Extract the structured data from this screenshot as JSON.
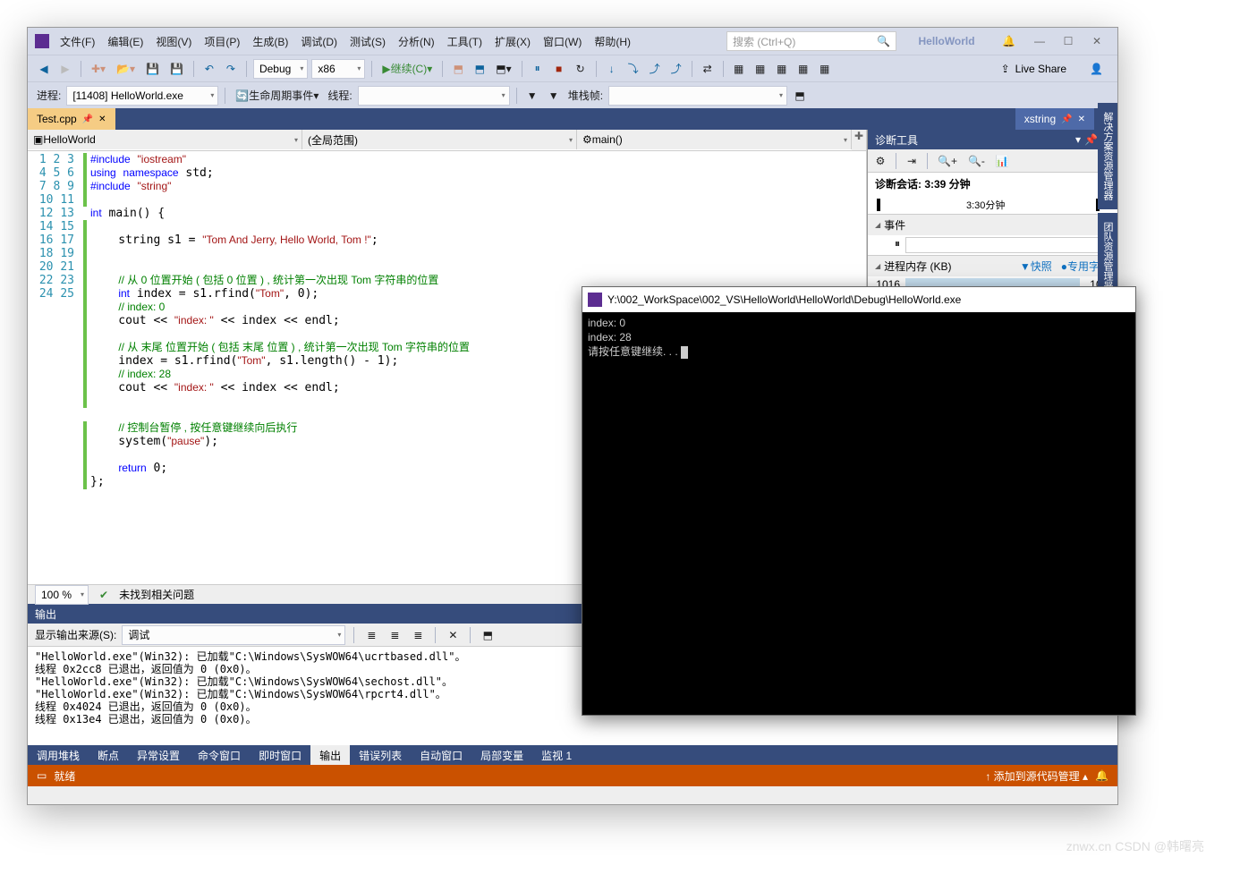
{
  "window_title": "HelloWorld",
  "menu": [
    "文件(F)",
    "编辑(E)",
    "视图(V)",
    "项目(P)",
    "生成(B)",
    "调试(D)",
    "测试(S)",
    "分析(N)",
    "工具(T)",
    "扩展(X)",
    "窗口(W)",
    "帮助(H)"
  ],
  "search_placeholder": "搜索 (Ctrl+Q)",
  "toolbar1": {
    "config": "Debug",
    "platform": "x86",
    "continue": "继续(C)",
    "liveshare": "Live Share"
  },
  "toolbar2": {
    "process_label": "进程:",
    "process_value": "[11408] HelloWorld.exe",
    "lifecycle": "生命周期事件",
    "thread_label": "线程:",
    "stackframe_label": "堆栈帧:"
  },
  "tabs": {
    "active": "Test.cpp",
    "right": "xstring"
  },
  "nav": {
    "project": "HelloWorld",
    "scope": "(全局范围)",
    "func": "main()"
  },
  "code_lines": [
    {
      "n": 1,
      "h": "<span class='kw'>#include</span> <span class='str'>\"iostream\"</span>"
    },
    {
      "n": 2,
      "h": "<span class='kw'>using</span> <span class='kw'>namespace</span> std;"
    },
    {
      "n": 3,
      "h": "<span class='kw'>#include</span> <span class='str'>\"string\"</span>"
    },
    {
      "n": 4,
      "h": ""
    },
    {
      "n": 5,
      "h": "<span class='kw'>int</span> main() {"
    },
    {
      "n": 6,
      "h": ""
    },
    {
      "n": 7,
      "h": "    string s1 = <span class='str'>\"Tom And Jerry, Hello World, Tom !\"</span>;"
    },
    {
      "n": 8,
      "h": ""
    },
    {
      "n": 9,
      "h": ""
    },
    {
      "n": 10,
      "h": "    <span class='cmt'>// 从 0 位置开始 ( 包括 0 位置 ) , 统计第一次出现 Tom 字符串的位置</span>"
    },
    {
      "n": 11,
      "h": "    <span class='kw'>int</span> index = s1.rfind(<span class='str'>\"Tom\"</span>, 0);"
    },
    {
      "n": 12,
      "h": "    <span class='cmt'>// index: 0</span>"
    },
    {
      "n": 13,
      "h": "    cout &lt;&lt; <span class='str'>\"index: \"</span> &lt;&lt; index &lt;&lt; endl;"
    },
    {
      "n": 14,
      "h": ""
    },
    {
      "n": 15,
      "h": "    <span class='cmt'>// 从 末尾 位置开始 ( 包括 末尾 位置 ) , 统计第一次出现 Tom 字符串的位置</span>"
    },
    {
      "n": 16,
      "h": "    index = s1.rfind(<span class='str'>\"Tom\"</span>, s1.length() - 1);"
    },
    {
      "n": 17,
      "h": "    <span class='cmt'>// index: 28</span>"
    },
    {
      "n": 18,
      "h": "    cout &lt;&lt; <span class='str'>\"index: \"</span> &lt;&lt; index &lt;&lt; endl;"
    },
    {
      "n": 19,
      "h": ""
    },
    {
      "n": 20,
      "h": ""
    },
    {
      "n": 21,
      "h": "    <span class='cmt'>// 控制台暂停 , 按任意键继续向后执行</span>"
    },
    {
      "n": 22,
      "h": "    system(<span class='str'>\"pause\"</span>);"
    },
    {
      "n": 23,
      "h": ""
    },
    {
      "n": 24,
      "h": "    <span class='kw'>return</span> 0;"
    },
    {
      "n": 25,
      "h": "};"
    }
  ],
  "zoom": "100 %",
  "issues": "未找到相关问题",
  "diag": {
    "title": "诊断工具",
    "session": "诊断会话: 3:39 分钟",
    "tick": "3:30分钟",
    "events": "事件",
    "memory": "进程内存 (KB)",
    "snapshot": "快照",
    "private": "专用字节",
    "val": "1016"
  },
  "side_tabs": [
    "解决方案资源管理器",
    "团队资源管理器"
  ],
  "output": {
    "title": "输出",
    "source_label": "显示输出来源(S):",
    "source_value": "调试",
    "text": "\"HelloWorld.exe\"(Win32): 已加载\"C:\\Windows\\SysWOW64\\ucrtbased.dll\"。\n线程 0x2cc8 已退出，返回值为 0 (0x0)。\n\"HelloWorld.exe\"(Win32): 已加载\"C:\\Windows\\SysWOW64\\sechost.dll\"。\n\"HelloWorld.exe\"(Win32): 已加载\"C:\\Windows\\SysWOW64\\rpcrt4.dll\"。\n线程 0x4024 已退出，返回值为 0 (0x0)。\n线程 0x13e4 已退出，返回值为 0 (0x0)。"
  },
  "bottom_tabs": [
    "调用堆栈",
    "断点",
    "异常设置",
    "命令窗口",
    "即时窗口",
    "输出",
    "错误列表",
    "自动窗口",
    "局部变量",
    "监视 1"
  ],
  "bottom_active": 5,
  "status": {
    "ready": "就绪",
    "scm": "添加到源代码管理"
  },
  "console": {
    "title": "Y:\\002_WorkSpace\\002_VS\\HelloWorld\\HelloWorld\\Debug\\HelloWorld.exe",
    "body": "index: 0\nindex: 28\n请按任意键继续. . . "
  },
  "watermark": "znwx.cn\nCSDN @韩曙亮"
}
